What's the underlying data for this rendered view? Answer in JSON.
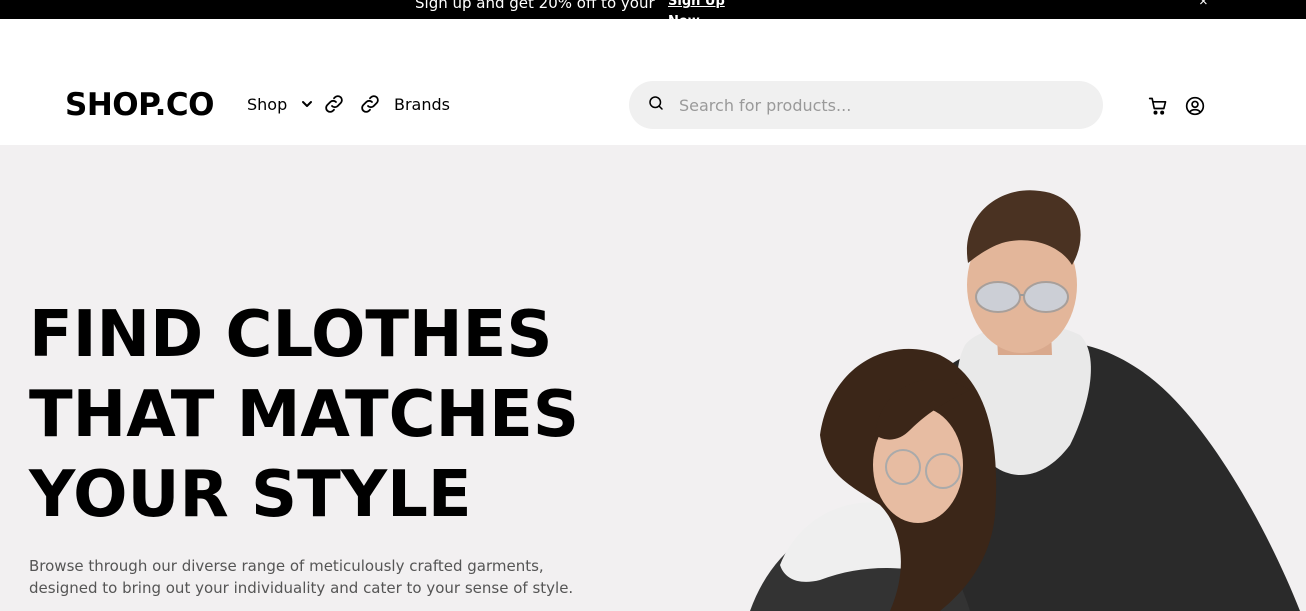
{
  "promo": {
    "message": "Sign up and get 20% off to your",
    "cta": "Sign Up Now",
    "close": "×"
  },
  "header": {
    "logo": "SHOP.CO",
    "nav": {
      "shop": "Shop",
      "brands": "Brands"
    },
    "search": {
      "placeholder": "Search for products..."
    }
  },
  "hero": {
    "headline": [
      "FIND CLOTHES",
      "THAT MATCHES",
      "YOUR STYLE"
    ],
    "subtext": "Browse through our diverse range of meticulously crafted garments, designed to bring out your individuality and cater to your sense of style."
  },
  "icons": {
    "shop_dropdown": "chevron-down-icon",
    "nav_link_1": "link-icon",
    "nav_link_2": "link-icon",
    "search": "search-icon",
    "cart": "cart-icon",
    "account": "user-circle-icon"
  },
  "colors": {
    "promo_bg": "#000000",
    "hero_bg": "#f2f0f1",
    "search_bg": "#f0f0f0"
  }
}
